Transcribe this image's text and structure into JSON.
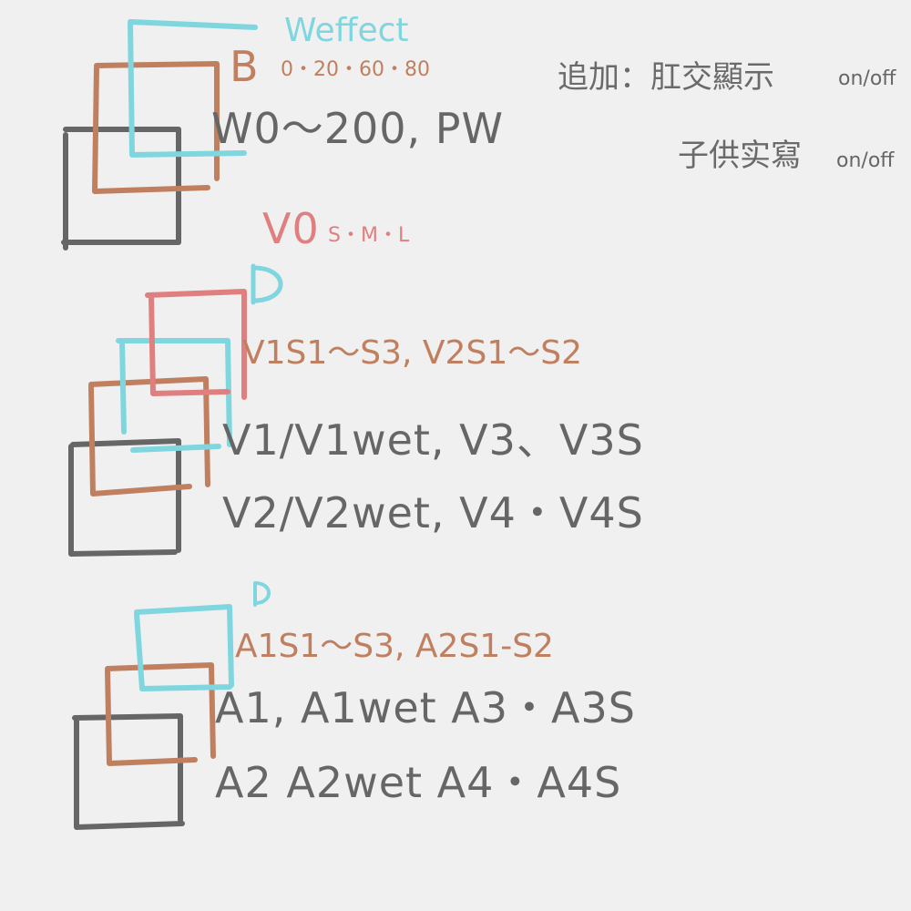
{
  "colors": {
    "layer_grey": "#666666",
    "layer_brown": "#c08060",
    "layer_cyan": "#7fd6de",
    "layer_red": "#e07f7f"
  },
  "top_group": {
    "effect_label": "Weffect",
    "b_label": "B",
    "b_values": "0・20・60・80",
    "w_line": "W0～200, PW"
  },
  "v_group": {
    "v0_label": "V0",
    "v0_sizes": "S・M・L",
    "d_label": "D",
    "shade_line": "V1S1～S3, V2S1～S2",
    "line1": "V1/V1wet, V3、V3S",
    "line2": "V2/V2wet, V4・V4S"
  },
  "a_group": {
    "d_label": "D",
    "shade_line": "A1S1～S3, A2S1-S2",
    "line1": "A1, A1wet A3・A3S",
    "line2": "A2  A2wet A4・A4S"
  },
  "notes": {
    "add_label": "追加：肛交顯示",
    "add_toggle": "on/off",
    "second_label": "子供实寫",
    "second_toggle": "on/off"
  }
}
